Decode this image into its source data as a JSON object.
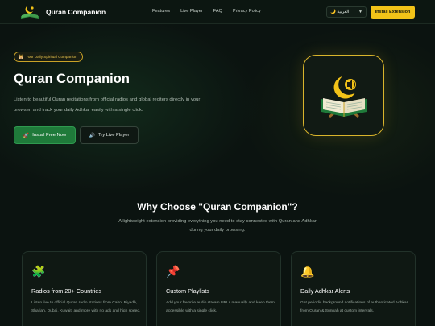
{
  "nav": {
    "brand": "Quran Companion",
    "links": [
      "Features",
      "Live Player",
      "FAQ",
      "Privacy Policy"
    ],
    "language": "🌙 العربية",
    "install_label": "Install Extension"
  },
  "hero": {
    "badge": "Your Daily Spiritual Companion",
    "badge_icon": "🕌",
    "title": "Quran Companion",
    "description": "Listen to beautiful Quran recitations from official radios and global reciters directly in your browser, and track your daily Adhkar easily with a single click.",
    "primary_button": "Install Free Now",
    "primary_icon": "🚀",
    "secondary_button": "Try Live Player",
    "secondary_icon": "🔊"
  },
  "features": {
    "title": "Why Choose \"Quran Companion\"?",
    "description": "A lightweight extension providing everything you need to stay connected with Quran and Adhkar during your daily browsing.",
    "cards": [
      {
        "icon": "🧩",
        "title": "Radios from 20+ Countries",
        "description": "Listen live to official Quran radio stations from Cairo, Riyadh, Sharjah, Dubai, Kuwait, and more with no ads and high speed."
      },
      {
        "icon": "📌",
        "title": "Custom Playlists",
        "description": "Add your favorite audio stream URLs manually and keep them accessible with a single click."
      },
      {
        "icon": "🔔",
        "title": "Daily Adhkar Alerts",
        "description": "Get periodic background notifications of authenticated Adhkar from Quran & Sunnah at custom intervals."
      }
    ]
  },
  "colors": {
    "background": "#0b1310",
    "accent_gold": "#f3c318",
    "primary_green": "#1f7a3a"
  }
}
